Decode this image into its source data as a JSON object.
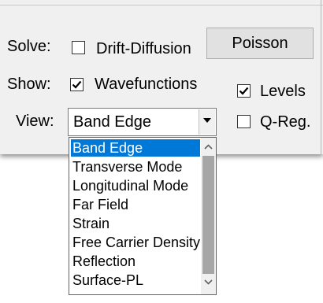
{
  "solve": {
    "label": "Solve:",
    "drift_diffusion": {
      "label": "Drift-Diffusion",
      "checked": false
    },
    "poisson_button": "Poisson"
  },
  "show": {
    "label": "Show:",
    "wavefunctions": {
      "label": "Wavefunctions",
      "checked": true
    },
    "levels": {
      "label": "Levels",
      "checked": true
    }
  },
  "view": {
    "label": "View:",
    "selected": "Band Edge",
    "qreg": {
      "label": "Q-Reg.",
      "checked": false
    },
    "options": [
      "Band Edge",
      "Transverse Mode",
      "Longitudinal Mode",
      "Far Field",
      "Strain",
      "Free Carrier Density",
      "Reflection",
      "Surface-PL"
    ]
  },
  "colors": {
    "selection": "#0078d7",
    "panel_bg": "#f0f0f0"
  }
}
